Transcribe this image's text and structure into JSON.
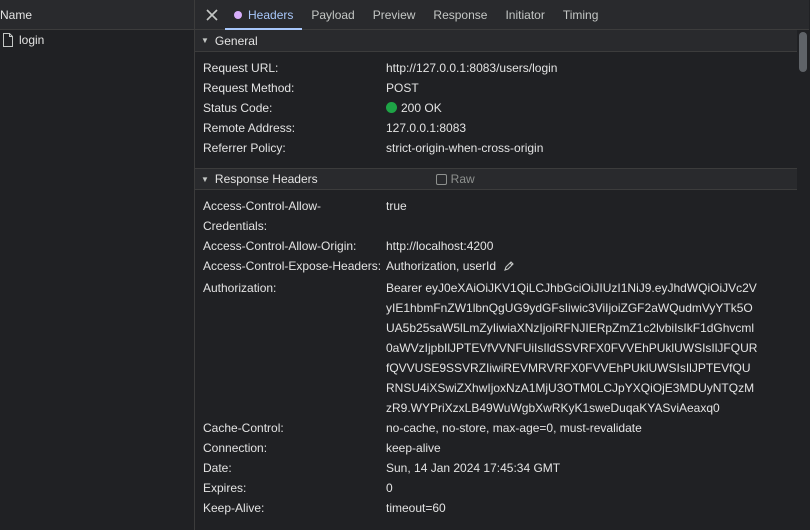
{
  "left": {
    "header": "Name",
    "requests": [
      {
        "name": "login",
        "icon": "file-icon"
      }
    ]
  },
  "tabs": {
    "close_icon": "close-icon",
    "items": [
      "Headers",
      "Payload",
      "Preview",
      "Response",
      "Initiator",
      "Timing"
    ],
    "active": "Headers"
  },
  "general": {
    "title": "General",
    "rows": [
      {
        "key": "Request URL:",
        "value": "http://127.0.0.1:8083/users/login"
      },
      {
        "key": "Request Method:",
        "value": "POST"
      },
      {
        "key": "Status Code:",
        "value": "200 OK"
      },
      {
        "key": "Remote Address:",
        "value": "127.0.0.1:8083"
      },
      {
        "key": "Referrer Policy:",
        "value": "strict-origin-when-cross-origin"
      }
    ]
  },
  "response_headers": {
    "title": "Response Headers",
    "raw_label": "Raw",
    "rows": [
      {
        "key": "Access-Control-Allow-Credentials:",
        "value": "true"
      },
      {
        "key": "Access-Control-Allow-Origin:",
        "value": "http://localhost:4200"
      },
      {
        "key": "Access-Control-Expose-Headers:",
        "value": "Authorization, userId"
      },
      {
        "key": "Authorization:",
        "value": "Bearer eyJ0eXAiOiJKV1QiLCJhbGciOiJIUzI1NiJ9.eyJhdWQiOiJVc2VyIE1hbmFnZW1lbnQgUG9ydGFsIiwic3ViIjoiZGF2aWQudmVyYTk5OUA5b25saW5lLmZyIiwiaXNzIjoiRFNJIERpZmZ1c2lvbiIsIkF1dGhvcml0aWVzIjpbIlJPTEVfVVNFUiIsIldSSVRFX0FVVEhPUklUWSIsIlJFQURfQVVUSE9SSVRZIiwiREVMRVRFX0FVVEhPUklUWSIsIlJPTEVfQURNSU4iXSwiZXhwIjoxNzA1MjU3OTM0LCJpYXQiOjE3MDUyNTQzMzR9.WYPriXzxLB49WuWgbXwRKyK1sweDuqaKYASviAeaxq0"
      },
      {
        "key": "Cache-Control:",
        "value": "no-cache, no-store, max-age=0, must-revalidate"
      },
      {
        "key": "Connection:",
        "value": "keep-alive"
      },
      {
        "key": "Date:",
        "value": "Sun, 14 Jan 2024 17:45:34 GMT"
      },
      {
        "key": "Expires:",
        "value": "0"
      },
      {
        "key": "Keep-Alive:",
        "value": "timeout=60"
      }
    ]
  },
  "colors": {
    "accent": "#a8c7fa",
    "status_ok": "#1ea446",
    "tab_dot": "#d7aefb",
    "background": "#202124"
  }
}
